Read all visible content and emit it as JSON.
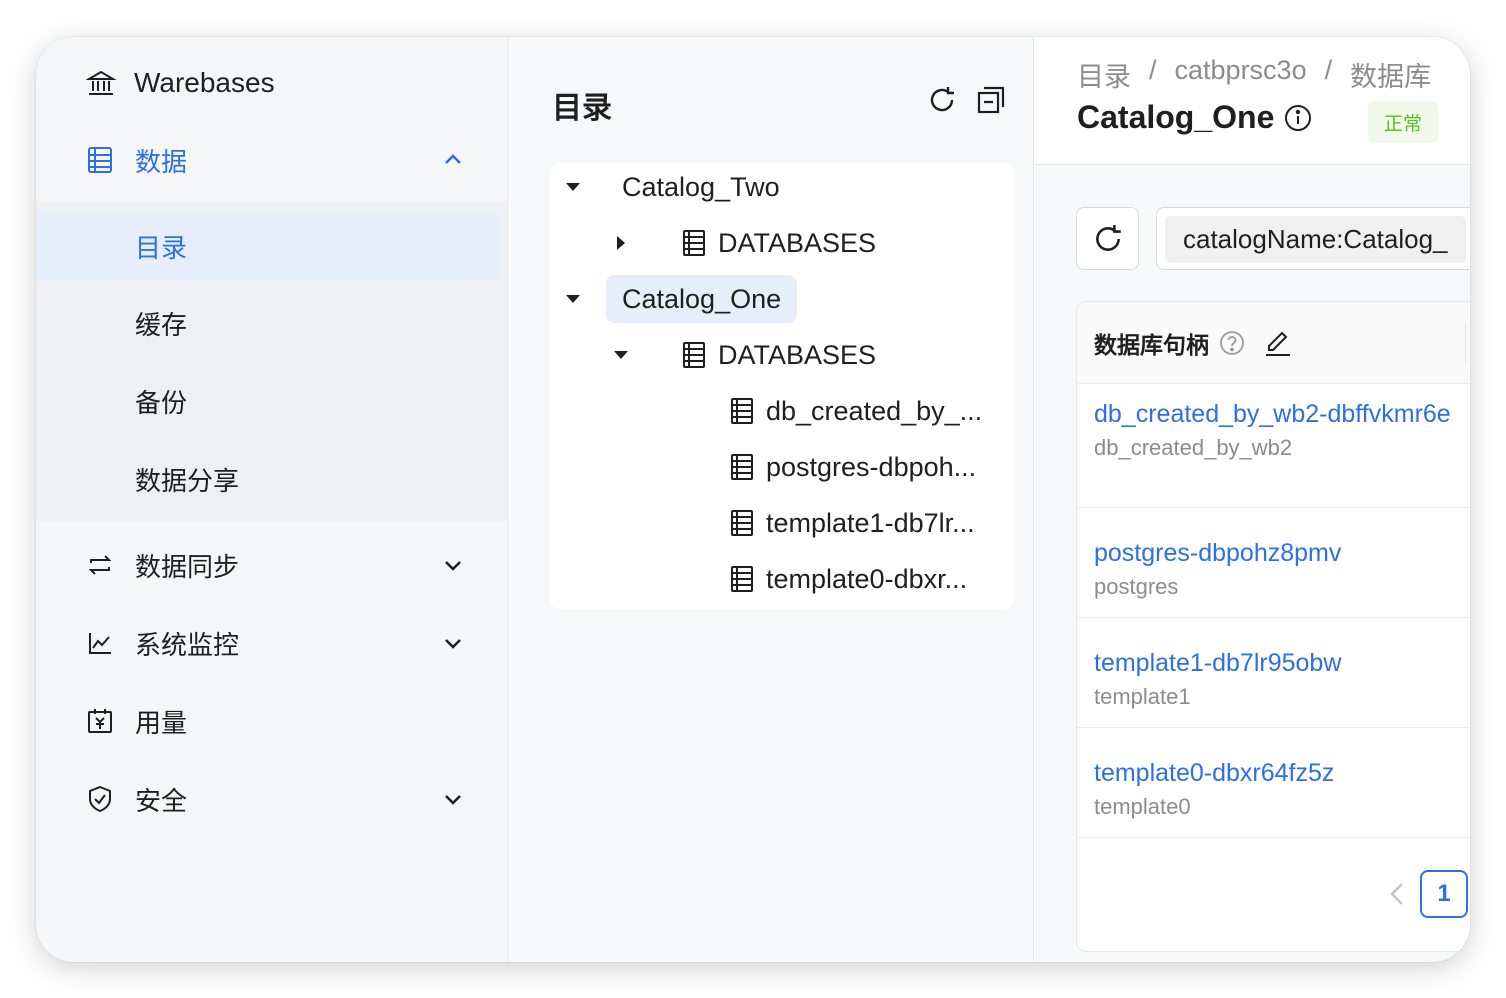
{
  "sidebar": {
    "brand": "Warebases",
    "data_section": {
      "label": "数据",
      "expanded": true
    },
    "data_items": [
      {
        "label": "目录",
        "selected": true
      },
      {
        "label": "缓存"
      },
      {
        "label": "备份"
      },
      {
        "label": "数据分享"
      }
    ],
    "nav": [
      {
        "label": "数据同步",
        "icon": "sync-icon"
      },
      {
        "label": "系统监控",
        "icon": "line-chart-icon"
      },
      {
        "label": "用量",
        "icon": "billing-calendar-icon"
      },
      {
        "label": "安全",
        "icon": "shield-check-icon"
      }
    ]
  },
  "tree": {
    "title": "目录",
    "nodes": [
      {
        "label": "Catalog_Two",
        "expanded": true
      },
      {
        "label": "DATABASES",
        "expanded": false
      },
      {
        "label": "Catalog_One",
        "expanded": true,
        "selected": true
      },
      {
        "label": "DATABASES",
        "expanded": true
      },
      {
        "label": "db_created_by_..."
      },
      {
        "label": "postgres-dbpoh..."
      },
      {
        "label": "template1-db7lr..."
      },
      {
        "label": "template0-dbxr..."
      }
    ]
  },
  "detail": {
    "breadcrumb": [
      "目录",
      "/",
      "catbprsc3o",
      "/",
      "数据库"
    ],
    "title": "Catalog_One",
    "status": "正常",
    "filter_tag": "catalogName:Catalog_",
    "column_header": "数据库句柄",
    "rows": [
      {
        "link": "db_created_by_wb2-dbffvkmr6e",
        "sub": "db_created_by_wb2"
      },
      {
        "link": "postgres-dbpohz8pmv",
        "sub": "postgres"
      },
      {
        "link": "template1-db7lr95obw",
        "sub": "template1"
      },
      {
        "link": "template0-dbxr64fz5z",
        "sub": "template0"
      }
    ],
    "current_page": "1"
  },
  "colors": {
    "accent": "#2f6fe4",
    "success": "#52c41a",
    "selected_bg": "#e6eefb"
  }
}
